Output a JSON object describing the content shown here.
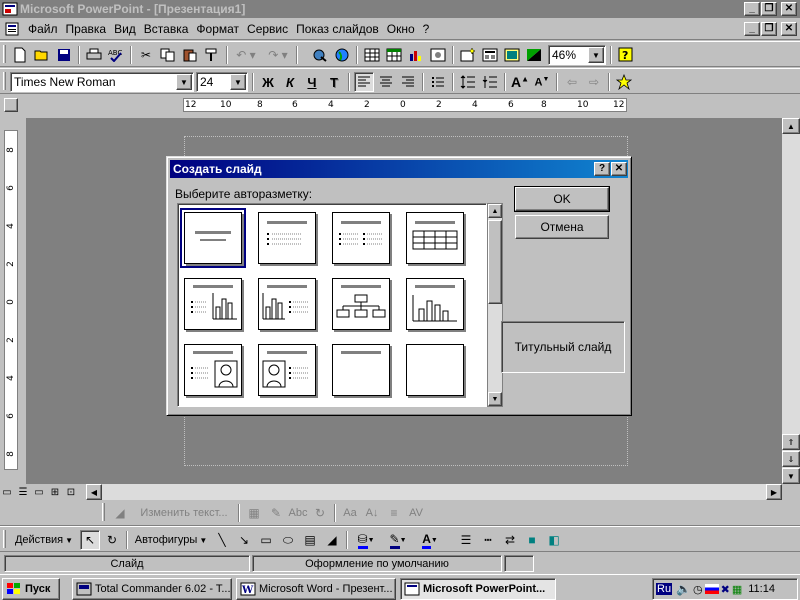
{
  "window": {
    "title": "Microsoft PowerPoint - [Презентация1]"
  },
  "menubar": {
    "items": [
      "Файл",
      "Правка",
      "Вид",
      "Вставка",
      "Формат",
      "Сервис",
      "Показ слайдов",
      "Окно",
      "?"
    ]
  },
  "standard_toolbar": {
    "zoom_value": "46%",
    "icons": [
      "new-icon",
      "open-icon",
      "save-icon",
      "print-icon",
      "spelling-icon",
      "cut-icon",
      "copy-icon",
      "paste-icon",
      "format-painter-icon",
      "undo-icon",
      "redo-icon",
      "hyperlink-icon",
      "web-toolbar-icon",
      "insert-table-icon",
      "insert-excel-icon",
      "insert-chart-icon",
      "insert-clipart-icon",
      "new-slide-icon",
      "slide-layout-icon",
      "apply-design-icon",
      "grayscale-icon",
      "help-icon"
    ]
  },
  "formatting_toolbar": {
    "font": "Times New Roman",
    "size": "24",
    "bold": "Ж",
    "italic": "К",
    "underline": "Ч",
    "shadow": "Т"
  },
  "ruler": {
    "h_ticks": [
      "12",
      "10",
      "8",
      "6",
      "4",
      "2",
      "0",
      "2",
      "4",
      "6",
      "8",
      "10",
      "12"
    ],
    "v_ticks": [
      "8",
      "6",
      "4",
      "2",
      "0",
      "2",
      "4",
      "6",
      "8"
    ]
  },
  "dialog": {
    "title": "Создать слайд",
    "help": "?",
    "close": "✕",
    "prompt": "Выберите авторазметку:",
    "ok": "OK",
    "cancel": "Отмена",
    "preview_label": "Титульный слайд",
    "layouts": [
      "title-slide",
      "bulleted-list",
      "two-column-text",
      "table",
      "text-and-chart",
      "chart-and-text",
      "organization-chart",
      "chart",
      "text-and-clipart",
      "clipart-and-text",
      "title-only",
      "blank"
    ]
  },
  "drawing_toolbar_top": {
    "edit_text": "Изменить текст..."
  },
  "drawing_toolbar": {
    "actions": "Действия",
    "autoshapes": "Автофигуры"
  },
  "statusbar": {
    "view": "Слайд",
    "design": "Оформление по умолчанию"
  },
  "taskbar": {
    "start": "Пуск",
    "tasks": [
      {
        "label": "Total Commander 6.02 - T..."
      },
      {
        "label": "Microsoft Word - Презент..."
      },
      {
        "label": "Microsoft PowerPoint..."
      }
    ],
    "lang": "Ru",
    "clock": "11:14"
  },
  "colors": {
    "titlebar_inactive": "#808080",
    "dialog_title_start": "#000080",
    "dialog_title_end": "#1084d0",
    "workspace": "#808080",
    "face": "#c0c0c0"
  }
}
